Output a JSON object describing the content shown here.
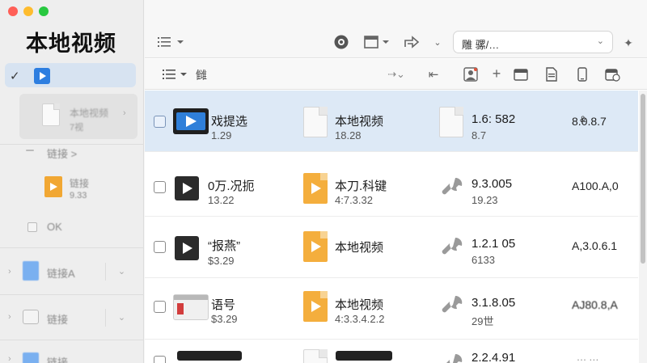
{
  "window": {
    "controls": [
      "close",
      "minimize",
      "zoom"
    ]
  },
  "sidebar": {
    "title": "本地视频",
    "selected_item": {
      "checked": true,
      "icon": "video-folder-icon"
    },
    "preview_card": {
      "label": "本地视频",
      "sublabel": "7视"
    },
    "items": [
      {
        "label": "链接 >",
        "icon": "checkbox-icon"
      },
      {
        "label": "链接",
        "sublabel": "9.33",
        "icon": "video-file-icon"
      },
      {
        "label": "OK",
        "icon": "checkbox-icon"
      },
      {
        "label": "链接A",
        "icon": "blue-doc-icon"
      },
      {
        "label": "链接",
        "icon": "archive-icon"
      },
      {
        "label": "链接",
        "icon": "blue-doc-icon"
      }
    ]
  },
  "toolbar": {
    "search_placeholder": "雕 骡/…",
    "sort_label": "雠"
  },
  "rows": [
    {
      "name": "戏提选",
      "sub": "1.29",
      "col2_name": "本地视频",
      "col2_sub": "18.28",
      "col3_name": "1.6: 582",
      "col3_sub": "8.7",
      "col4": "8.0.8.7",
      "col4_prefix": "&",
      "selected": true
    },
    {
      "name": "0万.况扼",
      "sub": "13.22",
      "col2_name": "本刀.科键",
      "col2_sub": "4:7.3.32",
      "col3_name": "9.3.005",
      "col3_sub": "19.23",
      "col4": "A100.A,0",
      "selected": false
    },
    {
      "name": "“报燕”",
      "sub": "$3.29",
      "col2_name": "本地视频",
      "col2_sub": "",
      "col3_name": "1.2.1 05",
      "col3_sub": "6133",
      "col4": "A,3.0.6.1",
      "selected": false
    },
    {
      "name": "语号",
      "sub": "$3.29",
      "col2_name": "本地视频",
      "col2_sub": "4:3.3.4.2.2",
      "col3_name": "3.1.8.05",
      "col3_sub": "29世",
      "col4": "AJ80.8,A",
      "selected": false
    },
    {
      "name": "",
      "sub": "",
      "col2_name": "",
      "col2_sub": "",
      "col3_name": "2.2.4.91",
      "col3_sub": "",
      "col4": "",
      "selected": false
    }
  ]
}
